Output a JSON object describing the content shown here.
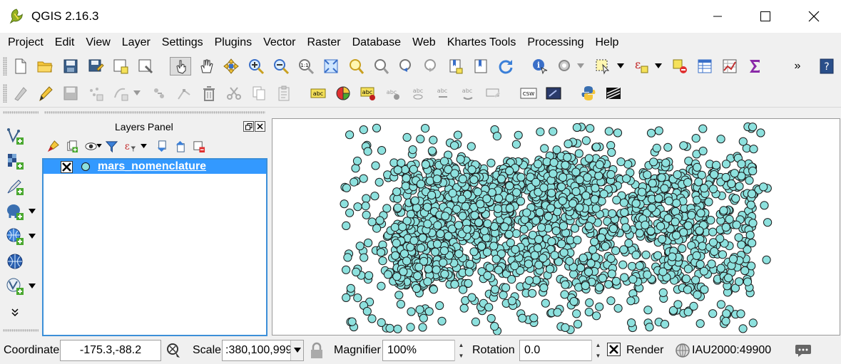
{
  "window": {
    "title": "QGIS 2.16.3"
  },
  "menu": [
    "Project",
    "Edit",
    "View",
    "Layer",
    "Settings",
    "Plugins",
    "Vector",
    "Raster",
    "Database",
    "Web",
    "Khartes Tools",
    "Processing",
    "Help"
  ],
  "toolbar_overflow": "»",
  "digitize_toolbar": {
    "label_icons": [
      "abc",
      "abc",
      "abc",
      "abc",
      "abc",
      "abc"
    ],
    "csw_label": "CSW"
  },
  "layers_panel": {
    "title": "Layers Panel",
    "layers": [
      {
        "name": "mars_nomenclature",
        "checked": true,
        "selected": true
      }
    ]
  },
  "map": {
    "point_fill": "#8de1de",
    "point_stroke": "#1a1a1a"
  },
  "statusbar": {
    "coordinate_label": "Coordinate",
    "coordinate_value": "-175.3,-88.2",
    "scale_label": "Scale",
    "scale_value": ":380,100,999",
    "magnifier_label": "Magnifier",
    "magnifier_value": "100%",
    "rotation_label": "Rotation",
    "rotation_value": "0.0",
    "render_label": "Render",
    "render_checked": true,
    "crs_label": "IAU2000:49900"
  },
  "colors": {
    "selection": "#3399ff",
    "panel_border": "#3c8fd8"
  }
}
